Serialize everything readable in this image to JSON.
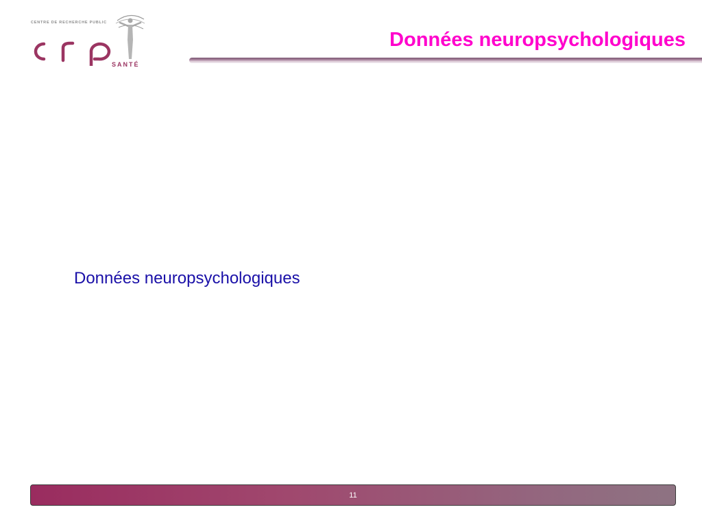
{
  "logo": {
    "org_line": "CENTRE DE RECHERCHE PUBLIC",
    "sante": "SANTÉ"
  },
  "slide": {
    "title": "Données neuropsychologiques",
    "body_text": "Données neuropsychologiques"
  },
  "footer": {
    "page_number": "11"
  },
  "colors": {
    "title": "#ff00cc",
    "body_text": "#1a10a8",
    "brand": "#9b3562",
    "footer_start": "#9a2c5f",
    "footer_end": "#8e7382"
  }
}
